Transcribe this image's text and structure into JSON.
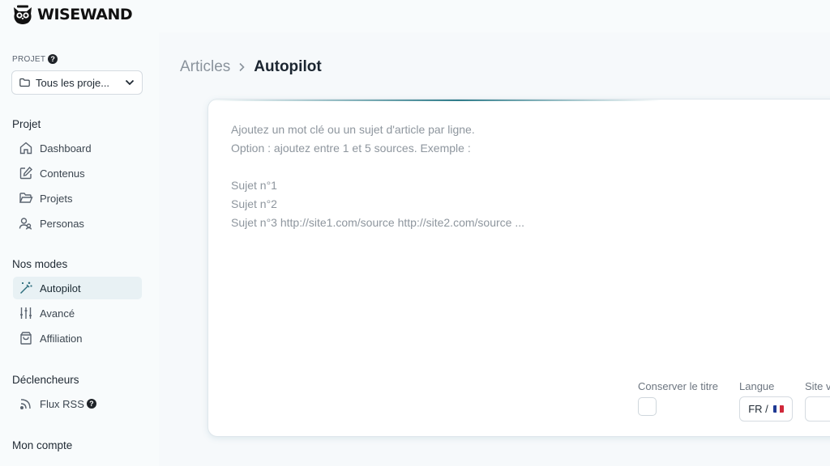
{
  "brand": {
    "name": "WISEWAND"
  },
  "sidebar": {
    "project_label": "PROJET",
    "project_select": {
      "value": "Tous les proje..."
    },
    "groups": [
      {
        "title": "Projet",
        "items": [
          {
            "label": "Dashboard",
            "icon": "home-icon"
          },
          {
            "label": "Contenus",
            "icon": "edit-icon"
          },
          {
            "label": "Projets",
            "icon": "folder-icon"
          },
          {
            "label": "Personas",
            "icon": "users-icon"
          }
        ]
      },
      {
        "title": "Nos modes",
        "items": [
          {
            "label": "Autopilot",
            "icon": "magic-wand-icon",
            "active": true
          },
          {
            "label": "Avancé",
            "icon": "sliders-icon"
          },
          {
            "label": "Affiliation",
            "icon": "shopping-bag-icon"
          }
        ]
      },
      {
        "title": "Déclencheurs",
        "items": [
          {
            "label": "Flux RSS",
            "icon": "rss-icon"
          }
        ]
      },
      {
        "title": "Mon compte",
        "items": []
      }
    ]
  },
  "breadcrumb": {
    "parent": "Articles",
    "current": "Autopilot"
  },
  "editor": {
    "placeholder": "Ajoutez un mot clé ou un sujet d'article par ligne.\nOption : ajoutez entre 1 et 5 sources. Exemple :\n\nSujet n°1\nSujet n°2\nSujet n°3 http://site1.com/source http://site2.com/source ...",
    "value": ""
  },
  "options": {
    "keep_title_label": "Conserver le titre",
    "language_label": "Langue",
    "language_value": "FR /",
    "site_label": "Site v"
  },
  "colors": {
    "accent": "#2f7c8a",
    "active_bg": "#e8f1f4"
  }
}
